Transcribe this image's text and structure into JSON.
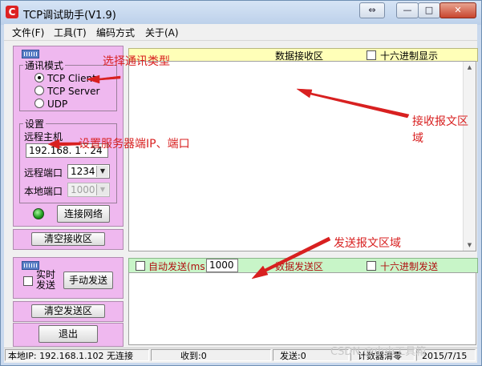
{
  "window": {
    "title": "TCP调试助手(V1.9)",
    "app_icon_letter": "C"
  },
  "caption_buttons": {
    "restore": "⇔",
    "minimize": "—",
    "maximize": "□",
    "close": "✕"
  },
  "menu": {
    "items": [
      "文件(F)",
      "工具(T)",
      "编码方式",
      "关于(A)"
    ]
  },
  "left_panel": {
    "comm_mode": {
      "legend": "通讯模式",
      "options": [
        {
          "label": "TCP Client",
          "selected": true
        },
        {
          "label": "TCP Server",
          "selected": false
        },
        {
          "label": "UDP",
          "selected": false
        }
      ]
    },
    "settings": {
      "legend": "设置",
      "remote_host_label": "远程主机",
      "remote_host_value": "192.168. 1 . 24",
      "remote_port_label": "远程端口",
      "remote_port_value": "1234",
      "local_port_label": "本地端口",
      "local_port_value": "1000"
    },
    "connect_button": "连接网络",
    "clear_receive_button": "清空接收区",
    "realtime_send_label_1": "实时",
    "realtime_send_label_2": "发送",
    "manual_send_button": "手动发送",
    "clear_send_button": "清空发送区",
    "exit_button": "退出"
  },
  "receive": {
    "title": "数据接收区",
    "hex_display_label": "十六进制显示"
  },
  "send": {
    "auto_send_label": "自动发送(ms)",
    "interval_value": "1000",
    "title": "数据发送区",
    "hex_send_label": "十六进制发送"
  },
  "status_bar": {
    "local_ip": "本地IP:  192.168.1.102 无连接",
    "received": "收到:0",
    "sent": "发送:0",
    "counter_reset": "计数器清零",
    "date": "2015/7/15"
  },
  "watermark": "CSDN @小小工具箱",
  "annotations": {
    "select_type": "选择通讯类型",
    "set_server": "设置服务器端IP、端口",
    "receive_area_1": "接收报文区",
    "receive_area_2": "域",
    "send_area": "发送报文区域"
  },
  "colors": {
    "annotation": "#d82020",
    "panel_pink": "#efb8ef",
    "receive_header": "#ffffb8",
    "send_header": "#c8f5c8"
  }
}
